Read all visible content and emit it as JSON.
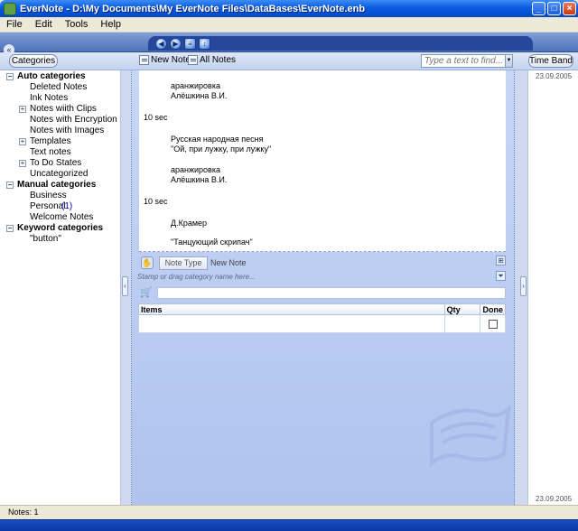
{
  "window": {
    "title": "EverNote - D:\\My Documents\\My EverNote Files\\DataBases\\EverNote.enb",
    "min_label": "_",
    "max_label": "□",
    "close_label": "×"
  },
  "menu": [
    "File",
    "Edit",
    "Tools",
    "Help"
  ],
  "toolbar": {
    "categories_label": "Categories",
    "new_note_label": "New Note",
    "all_notes_label": "All Notes",
    "search_placeholder": "Type a text to find...",
    "time_band_label": "Time Band"
  },
  "sidebar": {
    "auto_header": "Auto categories",
    "auto_items": [
      {
        "label": "Deleted Notes",
        "expand": ""
      },
      {
        "label": "Ink Notes",
        "expand": ""
      },
      {
        "label": "Notes wiith Clips",
        "expand": "+"
      },
      {
        "label": "Notes with Encryption",
        "expand": ""
      },
      {
        "label": "Notes with Images",
        "expand": ""
      },
      {
        "label": "Templates",
        "expand": "+"
      },
      {
        "label": "Text notes",
        "expand": ""
      },
      {
        "label": "To Do States",
        "expand": "+"
      },
      {
        "label": "Uncategorized",
        "expand": ""
      }
    ],
    "manual_header": "Manual categories",
    "manual_items": [
      {
        "label": "Business",
        "count": ""
      },
      {
        "label": "Personal",
        "count": "(1)"
      },
      {
        "label": "Welcome Notes",
        "count": ""
      }
    ],
    "keyword_header": "Keyword categories",
    "keyword_items": [
      "\"button\""
    ]
  },
  "note": {
    "lines": [
      {
        "text": "аранжировка",
        "indent": true
      },
      {
        "text": "Алёшкина В.И.",
        "indent": true
      },
      {
        "text": "10 sec",
        "indent": false
      },
      {
        "text": "Русская народная песня",
        "indent": true
      },
      {
        "text": "\"Ой, при лужку, при лужку\"",
        "indent": true
      },
      {
        "text": "аранжировка",
        "indent": true
      },
      {
        "text": "Алёшкина В.И.",
        "indent": true
      },
      {
        "text": "10 sec",
        "indent": false
      },
      {
        "text": "Д.Крамер",
        "indent": true
      },
      {
        "text": "\"Танцующий скрипач\"",
        "indent": true
      }
    ],
    "note_type_label": "Note Type",
    "new_note_text": "New Note",
    "stamp_hint": "Stamp or drag category name here...",
    "table_headers": {
      "items": "Items",
      "qty": "Qty",
      "done": "Done"
    }
  },
  "timeband": {
    "top_date": "23.09.2005",
    "bottom_date": "23.09.2005"
  },
  "status": {
    "notes": "Notes: 1"
  }
}
